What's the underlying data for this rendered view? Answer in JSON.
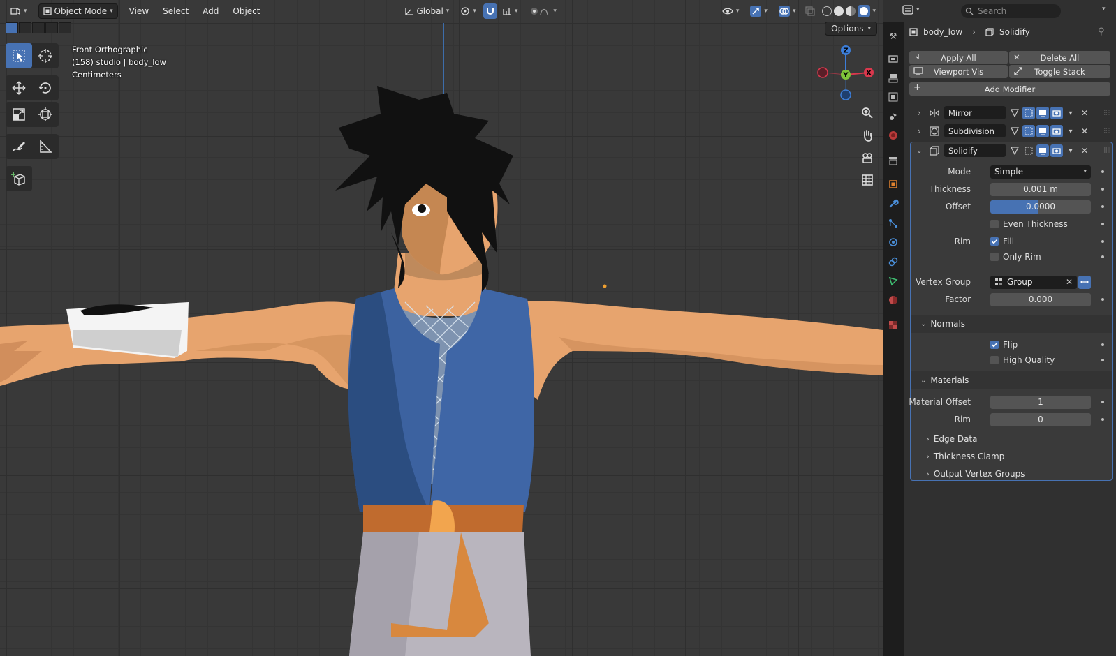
{
  "header": {
    "mode": "Object Mode",
    "menus": [
      "View",
      "Select",
      "Add",
      "Object"
    ],
    "transform_orientation": "Global",
    "options_label": "Options"
  },
  "viewport": {
    "view_name": "Front Orthographic",
    "collection_line": "(158) studio | body_low",
    "units": "Centimeters",
    "gizmo": {
      "x": "X",
      "y": "Y",
      "z": "Z"
    }
  },
  "props": {
    "search_placeholder": "Search",
    "object_name": "body_low",
    "modifier_name": "Solidify",
    "buttons": {
      "apply_all": "Apply All",
      "delete_all": "Delete All",
      "viewport_vis": "Viewport Vis",
      "toggle_stack": "Toggle Stack",
      "add_modifier": "Add Modifier"
    },
    "modifiers": [
      {
        "name": "Mirror",
        "expanded": false
      },
      {
        "name": "Subdivision",
        "expanded": false
      },
      {
        "name": "Solidify",
        "expanded": true
      }
    ],
    "solidify": {
      "mode_label": "Mode",
      "mode_value": "Simple",
      "thickness_label": "Thickness",
      "thickness_value": "0.001 m",
      "offset_label": "Offset",
      "offset_value": "0.0000",
      "even_thickness": "Even Thickness",
      "rim_label": "Rim",
      "fill": "Fill",
      "only_rim": "Only Rim",
      "vertex_group_label": "Vertex Group",
      "vertex_group_value": "Group",
      "factor_label": "Factor",
      "factor_value": "0.000",
      "normals_header": "Normals",
      "flip": "Flip",
      "high_quality": "High Quality",
      "materials_header": "Materials",
      "material_offset_label": "Material Offset",
      "material_offset_value": "1",
      "rim_mat_label": "Rim",
      "rim_mat_value": "0",
      "edge_data": "Edge Data",
      "thickness_clamp": "Thickness Clamp",
      "output_vertex_groups": "Output Vertex Groups"
    }
  },
  "colors": {
    "accent": "#4772b3",
    "panel": "#303030",
    "viewport": "#393939"
  }
}
